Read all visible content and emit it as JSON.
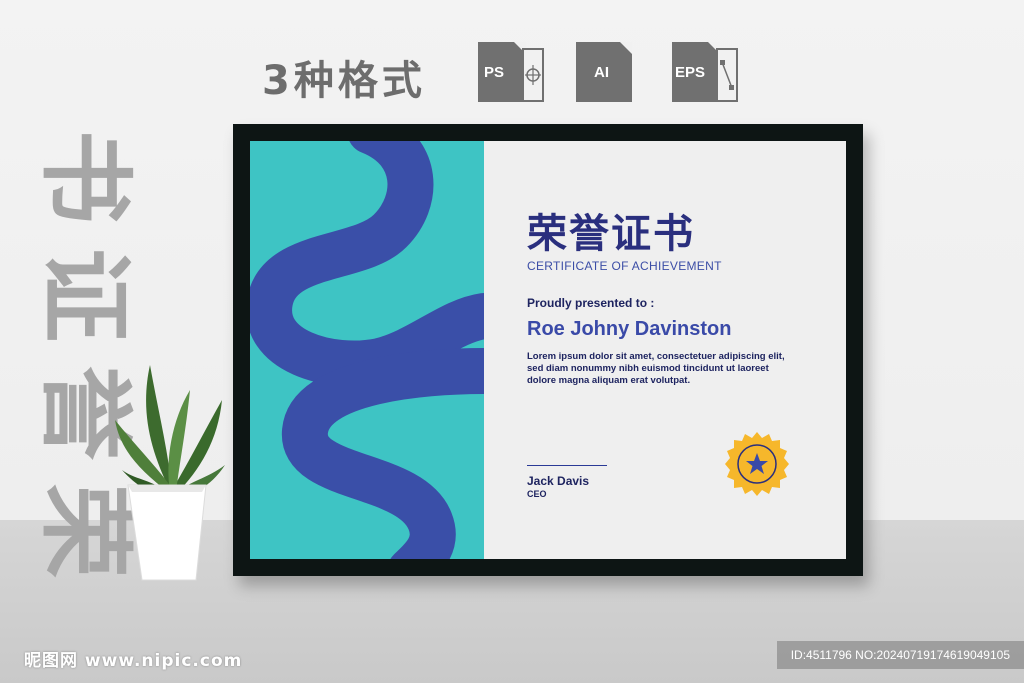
{
  "header": {
    "formats_label": "3种格式",
    "formats": [
      {
        "name": "PS",
        "icon": "photoshop-file-icon"
      },
      {
        "name": "AI",
        "icon": "illustrator-file-icon"
      },
      {
        "name": "EPS",
        "icon": "eps-file-icon"
      }
    ]
  },
  "vertical_title": [
    "书",
    "证",
    "誉",
    "荣"
  ],
  "certificate": {
    "title_cn": "荣誉证书",
    "title_en": "CERTIFICATE OF ACHIEVEMENT",
    "presented_label": "Proudly presented to :",
    "recipient": "Roe Johny Davinston",
    "body": "Lorem ipsum dolor sit amet, consectetuer adipiscing elit, sed diam nonummy nibh euismod tincidunt ut laoreet dolore magna aliquam erat volutpat.",
    "signer_name": "Jack Davis",
    "signer_role": "CEO",
    "seal_icon": "star-badge-icon"
  },
  "colors": {
    "teal": "#3ec4c4",
    "navy": "#2a2f7e",
    "blue": "#3a4aa8",
    "seal_yellow": "#f6b72b"
  },
  "footer": {
    "site": "昵图网 www.nipic.com",
    "id_text": "ID:4511796 NO:20240719174619049105"
  }
}
